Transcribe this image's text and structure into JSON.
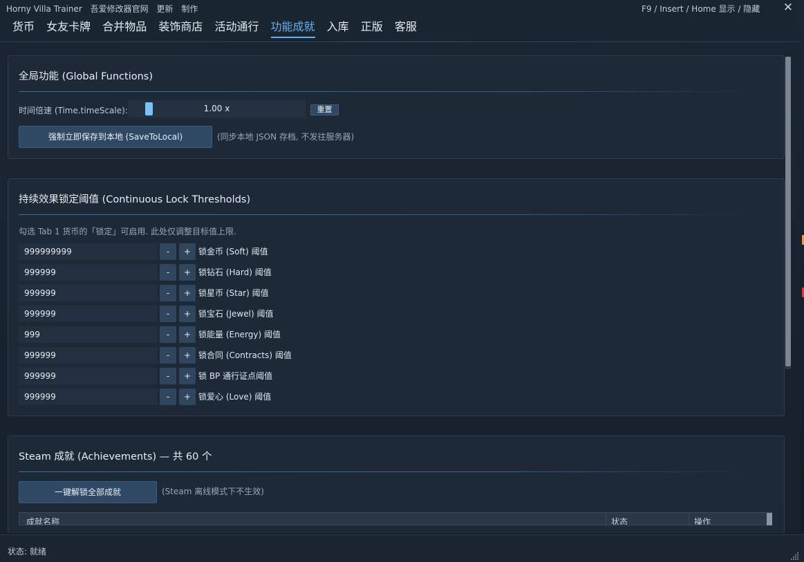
{
  "titlebar": {
    "app_name": "Horny Villa Trainer",
    "links": [
      "吾爱修改器官网",
      "更新",
      "制作"
    ],
    "hotkey_hint": "F9 / Insert / Home  显示 / 隐藏",
    "close_glyph": "✕"
  },
  "tabs": [
    {
      "label": "货币"
    },
    {
      "label": "女友卡牌"
    },
    {
      "label": "合并物品"
    },
    {
      "label": "装饰商店"
    },
    {
      "label": "活动通行"
    },
    {
      "label": "功能成就",
      "active": true
    },
    {
      "label": "入库"
    },
    {
      "label": "正版"
    },
    {
      "label": "客服"
    }
  ],
  "global": {
    "title": "全局功能 (Global Functions)",
    "timescale_label": "时间倍速 (Time.timeScale):",
    "timescale_value": "1.00 x",
    "timescale_level": 0.1,
    "reset_label": "重置",
    "save_button": "强制立即保存到本地 (SaveToLocal)",
    "save_note": "(同步本地 JSON 存档, 不发往服务器)"
  },
  "thresholds": {
    "title": "持续效果锁定阈值 (Continuous Lock Thresholds)",
    "note": "勾选 Tab 1 货币的「锁定」可启用. 此处仅调整目标值上限.",
    "minus": "-",
    "plus": "+",
    "rows": [
      {
        "value": "999999999",
        "label": "锁金币 (Soft) 阈值"
      },
      {
        "value": "999999",
        "label": "锁钻石 (Hard) 阈值"
      },
      {
        "value": "999999",
        "label": "锁星币 (Star) 阈值"
      },
      {
        "value": "999999",
        "label": "锁宝石 (Jewel) 阈值"
      },
      {
        "value": "999",
        "label": "锁能量 (Energy) 阈值"
      },
      {
        "value": "999999",
        "label": "锁合同 (Contracts) 阈值"
      },
      {
        "value": "999999",
        "label": "锁 BP 通行证点阈值"
      },
      {
        "value": "999999",
        "label": "锁爱心 (Love) 阈值"
      }
    ]
  },
  "achievements": {
    "title": "Steam 成就 (Achievements) — 共 60 个",
    "unlock_button": "一键解锁全部成就",
    "unlock_note": "(Steam 离线模式下不生效)",
    "columns": [
      "成就名称",
      "状态",
      "操作"
    ]
  },
  "status": {
    "text": "状态: 就绪"
  },
  "colors": {
    "accent": "#6ab0ee",
    "background": "#17212d",
    "card": "#1d2937",
    "button": "#2f4964"
  }
}
